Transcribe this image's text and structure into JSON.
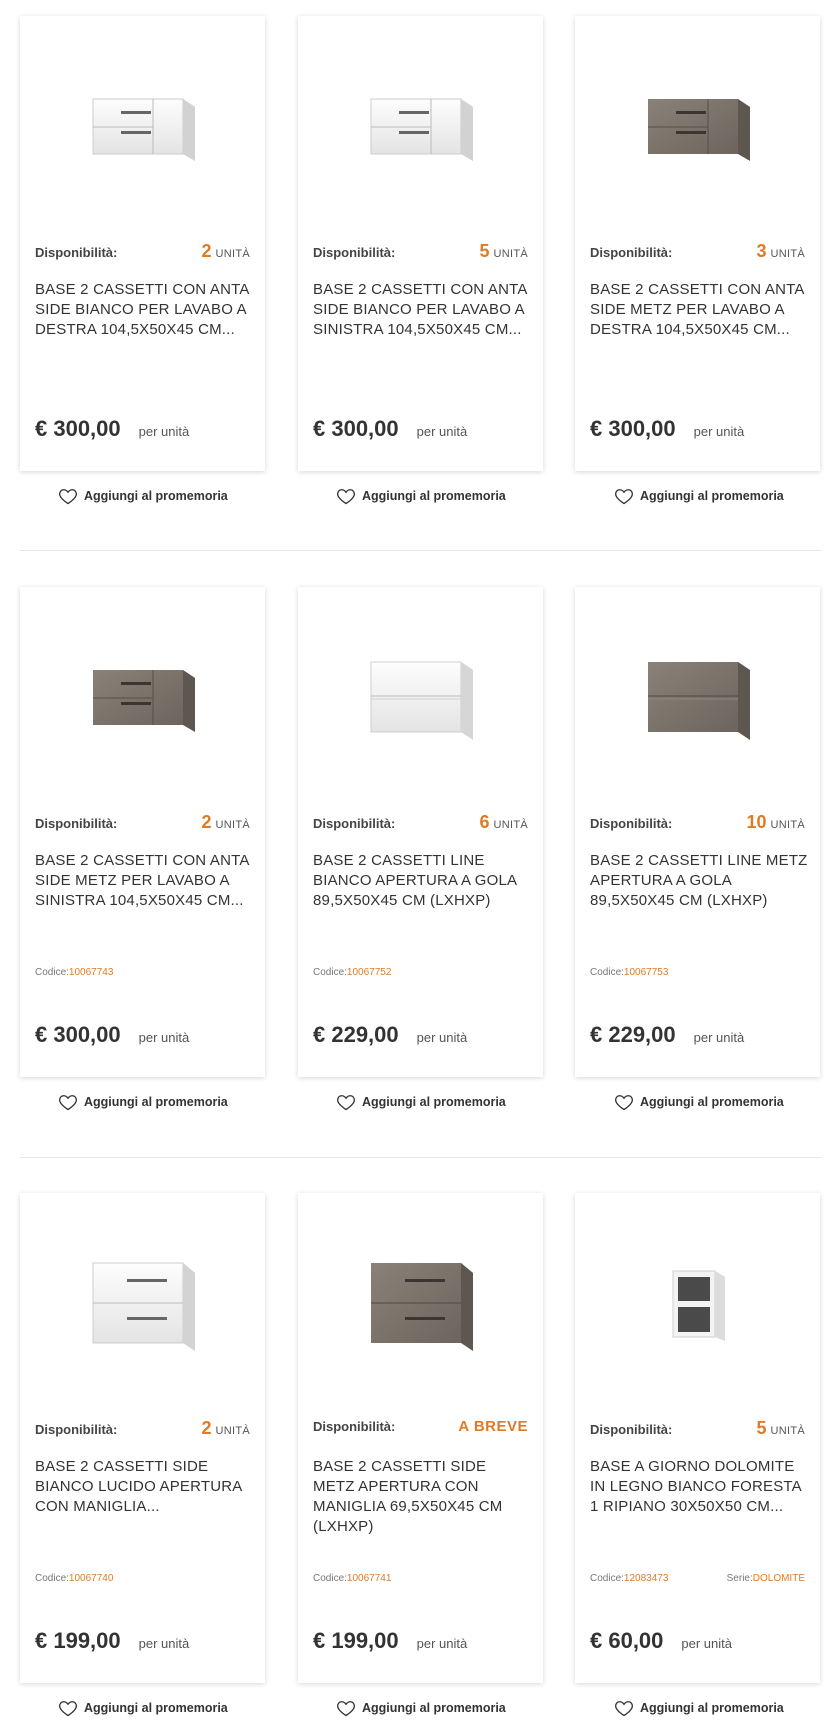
{
  "common": {
    "availability_label": "Disponibilità:",
    "unit_label": "UNITÀ",
    "per_unit": "per unità",
    "reminder_label": "Aggiungi al promemoria",
    "code_label": "Codice:",
    "series_label": "Serie:",
    "accent_color": "#e07b24"
  },
  "products": [
    {
      "availability": "2",
      "title": "BASE 2 CASSETTI CON ANTA SIDE BIANCO PER LAVABO A DESTRA 104,5X50X45 CM...",
      "price": "€ 300,00",
      "image_icon": "white-cabinet-with-side-door"
    },
    {
      "availability": "5",
      "title": "BASE 2 CASSETTI CON ANTA SIDE BIANCO PER LAVABO A SINISTRA 104,5X50X45 CM...",
      "price": "€ 300,00",
      "image_icon": "white-cabinet-with-side-door"
    },
    {
      "availability": "3",
      "title": "BASE 2 CASSETTI CON ANTA SIDE METZ PER LAVABO A DESTRA 104,5X50X45 CM...",
      "price": "€ 300,00",
      "image_icon": "wood-cabinet-with-side-door"
    },
    {
      "availability": "2",
      "title": "BASE 2 CASSETTI CON ANTA SIDE METZ PER LAVABO A SINISTRA 104,5X50X45 CM...",
      "code": "10067743",
      "price": "€ 300,00",
      "image_icon": "wood-cabinet-with-side-door"
    },
    {
      "availability": "6",
      "title": "BASE 2 CASSETTI LINE BIANCO APERTURA A GOLA 89,5X50X45 CM (LXHXP)",
      "code": "10067752",
      "price": "€ 229,00",
      "image_icon": "white-cabinet-two-drawers"
    },
    {
      "availability": "10",
      "title": "BASE 2 CASSETTI LINE METZ APERTURA A GOLA 89,5X50X45 CM (LXHXP)",
      "code": "10067753",
      "price": "€ 229,00",
      "image_icon": "wood-cabinet-two-drawers"
    },
    {
      "availability": "2",
      "title": "BASE 2 CASSETTI SIDE BIANCO LUCIDO APERTURA CON MANIGLIA...",
      "code": "10067740",
      "price": "€ 199,00",
      "image_icon": "white-cabinet-two-drawers-handles"
    },
    {
      "availability_text": "A BREVE",
      "title": "BASE 2 CASSETTI SIDE METZ APERTURA CON MANIGLIA 69,5X50X45 CM (LXHXP)",
      "code": "10067741",
      "price": "€ 199,00",
      "image_icon": "wood-cabinet-two-drawers-handles"
    },
    {
      "availability": "5",
      "title": "BASE A GIORNO DOLOMITE IN LEGNO BIANCO FORESTA 1 RIPIANO 30X50X50 CM...",
      "code": "12083473",
      "series": "DOLOMITE",
      "price": "€ 60,00",
      "image_icon": "open-shelf-unit"
    }
  ]
}
